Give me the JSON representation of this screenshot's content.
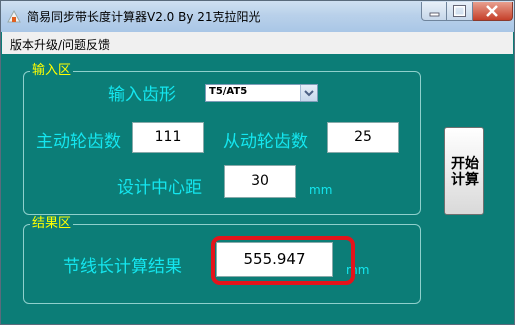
{
  "window": {
    "title": "简易同步带长度计算器V2.0  By 21克拉阳光",
    "icons": {
      "app": "app-icon",
      "minimize": "minimize-icon",
      "maximize": "maximize-icon",
      "close": "close-icon"
    }
  },
  "menu": {
    "items": [
      "版本升级/问题反馈"
    ]
  },
  "input_group": {
    "title": "输入区",
    "tooth_profile_label": "输入齿形",
    "tooth_profile_value": "T5/AT5",
    "driving_teeth_label": "主动轮齿数",
    "driving_teeth_value": "111",
    "driven_teeth_label": "从动轮齿数",
    "driven_teeth_value": "25",
    "center_distance_label": "设计中心距",
    "center_distance_value": "30",
    "center_distance_unit": "mm"
  },
  "result_group": {
    "title": "结果区",
    "pitch_length_label": "节线长计算结果",
    "pitch_length_value": "555.947",
    "pitch_length_unit": "mm"
  },
  "calculate_button": {
    "label": "开始计算"
  },
  "colors": {
    "background": "#0c7d77",
    "label": "#14e6ef",
    "legend": "#ffff00",
    "highlight": "#e4141b"
  }
}
